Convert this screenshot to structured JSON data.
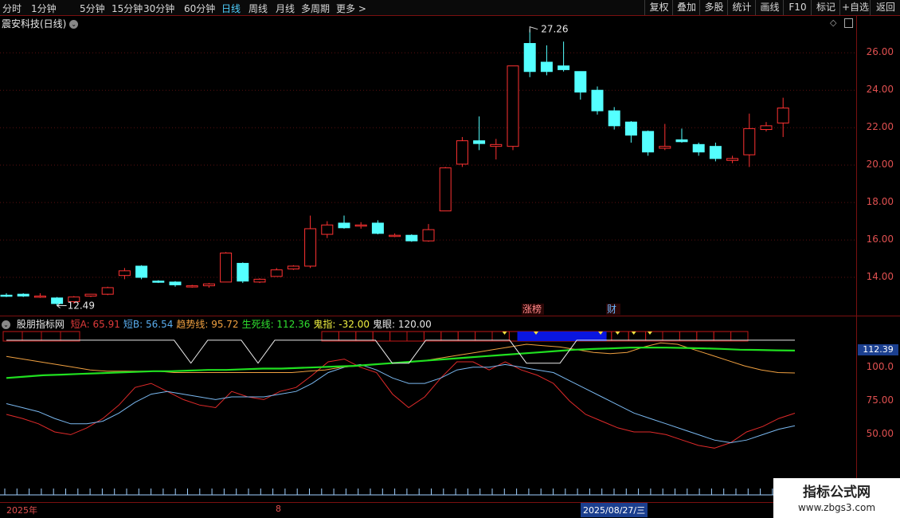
{
  "toolbar": {
    "periods": [
      "分时",
      "1分钟",
      "5分钟",
      "15分钟",
      "30分钟",
      "60分钟",
      "日线",
      "周线",
      "月线",
      "多周期",
      "更多 >"
    ],
    "active_period": "日线",
    "right_buttons": [
      "复权",
      "叠加",
      "多股",
      "统计",
      "画线",
      "F10",
      "标记",
      "+自选",
      "返回"
    ]
  },
  "stock": {
    "name": "震安科技(日线)"
  },
  "price_axis": {
    "labels": [
      "26.00",
      "24.00",
      "22.00",
      "20.00",
      "18.00",
      "16.00",
      "14.00"
    ]
  },
  "annotations": {
    "high_label": "27.26",
    "low_label": "12.49",
    "tags": [
      "涨榜",
      "财"
    ]
  },
  "indicator": {
    "name": "股朋指标网",
    "items": [
      {
        "label": "短A: 65.91",
        "color": "#e03a3a"
      },
      {
        "label": "短B: 56.54",
        "color": "#5aaef0"
      },
      {
        "label": "趋势线: 95.72",
        "color": "#f0a040"
      },
      {
        "label": "生死线: 112.36",
        "color": "#30e030"
      },
      {
        "label": "鬼指: -32.00",
        "color": "#f0f040"
      },
      {
        "label": "鬼眼: 120.00",
        "color": "#e8e8e8"
      }
    ],
    "axis_labels": [
      "100.0",
      "75.00",
      "50.00"
    ],
    "current_badge": "112.39"
  },
  "date_axis": {
    "labels": [
      "2025年",
      "8"
    ],
    "cursor_date": "2025/08/27/三"
  },
  "watermark": {
    "title": "指标公式网",
    "url": "www.zbgs3.com"
  },
  "chart_data": {
    "type": "candlestick",
    "ylim": [
      12.0,
      27.8
    ],
    "ohlc": [
      [
        13.05,
        13.15,
        12.95,
        13.0
      ],
      [
        13.1,
        13.15,
        12.95,
        13.0
      ],
      [
        13.0,
        13.15,
        12.9,
        13.0
      ],
      [
        12.9,
        12.95,
        12.49,
        12.6
      ],
      [
        12.7,
        13.0,
        12.6,
        12.95
      ],
      [
        13.0,
        13.1,
        12.95,
        13.1
      ],
      [
        13.1,
        13.5,
        13.05,
        13.45
      ],
      [
        14.1,
        14.5,
        13.9,
        14.35
      ],
      [
        14.6,
        14.65,
        13.9,
        14.0
      ],
      [
        13.8,
        13.85,
        13.7,
        13.75
      ],
      [
        13.75,
        13.8,
        13.5,
        13.6
      ],
      [
        13.5,
        13.6,
        13.45,
        13.55
      ],
      [
        13.55,
        13.7,
        13.45,
        13.65
      ],
      [
        13.75,
        15.35,
        13.75,
        15.3
      ],
      [
        14.75,
        14.8,
        13.7,
        13.8
      ],
      [
        13.75,
        13.95,
        13.7,
        13.9
      ],
      [
        14.05,
        14.5,
        14.05,
        14.4
      ],
      [
        14.45,
        14.65,
        14.4,
        14.6
      ],
      [
        14.6,
        17.3,
        14.5,
        16.6
      ],
      [
        16.3,
        17.0,
        16.1,
        16.8
      ],
      [
        16.9,
        17.3,
        16.6,
        16.65
      ],
      [
        16.75,
        16.95,
        16.6,
        16.8
      ],
      [
        16.9,
        17.05,
        16.3,
        16.35
      ],
      [
        16.25,
        16.35,
        16.15,
        16.25
      ],
      [
        16.25,
        16.3,
        15.9,
        15.95
      ],
      [
        15.95,
        16.85,
        15.9,
        16.55
      ],
      [
        17.55,
        19.9,
        17.55,
        19.85
      ],
      [
        20.05,
        21.5,
        19.9,
        21.3
      ],
      [
        21.3,
        22.6,
        20.8,
        21.15
      ],
      [
        21.0,
        21.4,
        20.3,
        21.1
      ],
      [
        21.0,
        25.3,
        20.8,
        25.3
      ],
      [
        26.5,
        27.26,
        24.7,
        25.0
      ],
      [
        25.5,
        26.4,
        24.8,
        25.0
      ],
      [
        25.3,
        26.6,
        25.0,
        25.1
      ],
      [
        25.0,
        25.0,
        23.5,
        23.9
      ],
      [
        24.0,
        24.2,
        22.7,
        22.9
      ],
      [
        22.9,
        23.1,
        21.9,
        22.1
      ],
      [
        22.3,
        22.35,
        21.2,
        21.6
      ],
      [
        21.8,
        21.85,
        20.5,
        20.7
      ],
      [
        20.9,
        22.2,
        20.8,
        21.0
      ],
      [
        21.35,
        21.95,
        21.2,
        21.25
      ],
      [
        21.1,
        21.2,
        20.5,
        20.7
      ],
      [
        21.0,
        21.2,
        20.2,
        20.35
      ],
      [
        20.25,
        20.5,
        20.1,
        20.35
      ],
      [
        20.55,
        22.75,
        19.9,
        21.95
      ],
      [
        21.9,
        22.3,
        21.8,
        22.1
      ],
      [
        22.25,
        23.6,
        21.5,
        23.05
      ]
    ],
    "indicator": {
      "ylim": [
        0,
        130
      ],
      "series": [
        {
          "name": "短A",
          "values": [
            65,
            62,
            58,
            52,
            50,
            55,
            62,
            72,
            85,
            88,
            82,
            76,
            72,
            70,
            82,
            78,
            76,
            82,
            85,
            94,
            104,
            106,
            100,
            96,
            80,
            70,
            78,
            92,
            104,
            104,
            98,
            104,
            98,
            94,
            88,
            75,
            65,
            60,
            55,
            52,
            52,
            50,
            46,
            42,
            40,
            44,
            52,
            56,
            62,
            65.91
          ]
        },
        {
          "name": "短B",
          "values": [
            73,
            70,
            67,
            62,
            58,
            58,
            60,
            66,
            74,
            80,
            82,
            80,
            78,
            76,
            78,
            78,
            78,
            80,
            82,
            88,
            96,
            100,
            102,
            98,
            92,
            88,
            88,
            92,
            98,
            100,
            100,
            102,
            100,
            98,
            96,
            90,
            84,
            78,
            72,
            66,
            62,
            58,
            54,
            50,
            46,
            44,
            46,
            50,
            54,
            56.54
          ]
        },
        {
          "name": "趋势线",
          "values": [
            108,
            106,
            104,
            102,
            100,
            98,
            97,
            97,
            97,
            97,
            96,
            96,
            96,
            96,
            96,
            96,
            96,
            96,
            97,
            98,
            100,
            101,
            102,
            103,
            104,
            105,
            107,
            109,
            111,
            113,
            115,
            117,
            116,
            115,
            113,
            111,
            110,
            111,
            115,
            118,
            117,
            113,
            109,
            105,
            101,
            98,
            96,
            95.72
          ]
        },
        {
          "name": "生死线",
          "values": [
            92,
            93,
            94,
            94.5,
            95,
            95.5,
            96,
            96.5,
            97,
            97,
            97.5,
            98,
            98,
            98.5,
            99,
            99,
            99.5,
            100,
            100.5,
            101,
            102,
            103,
            104,
            105,
            106,
            107,
            108,
            109,
            110,
            111,
            112,
            113,
            113.5,
            114,
            114.5,
            114.6,
            114.5,
            114.3,
            114,
            113.6,
            113,
            112.8,
            112.5,
            112.36
          ]
        },
        {
          "name": "鬼眼",
          "values": [
            120,
            120,
            120,
            120,
            120,
            120,
            120,
            120,
            120,
            120,
            120,
            103,
            120,
            120,
            120,
            103,
            120,
            120,
            120,
            120,
            120,
            120,
            120,
            103,
            103,
            120,
            120,
            120,
            120,
            120,
            120,
            103,
            103,
            103,
            120,
            120,
            120,
            120,
            120,
            120,
            120,
            120,
            120,
            120,
            120,
            120,
            120,
            120
          ]
        }
      ]
    },
    "signal_strip": {
      "blue_fill_range": [
        0.605,
        0.71
      ],
      "yellow_markers": [
        0.59,
        0.627,
        0.703,
        0.723,
        0.742,
        0.761
      ]
    }
  }
}
